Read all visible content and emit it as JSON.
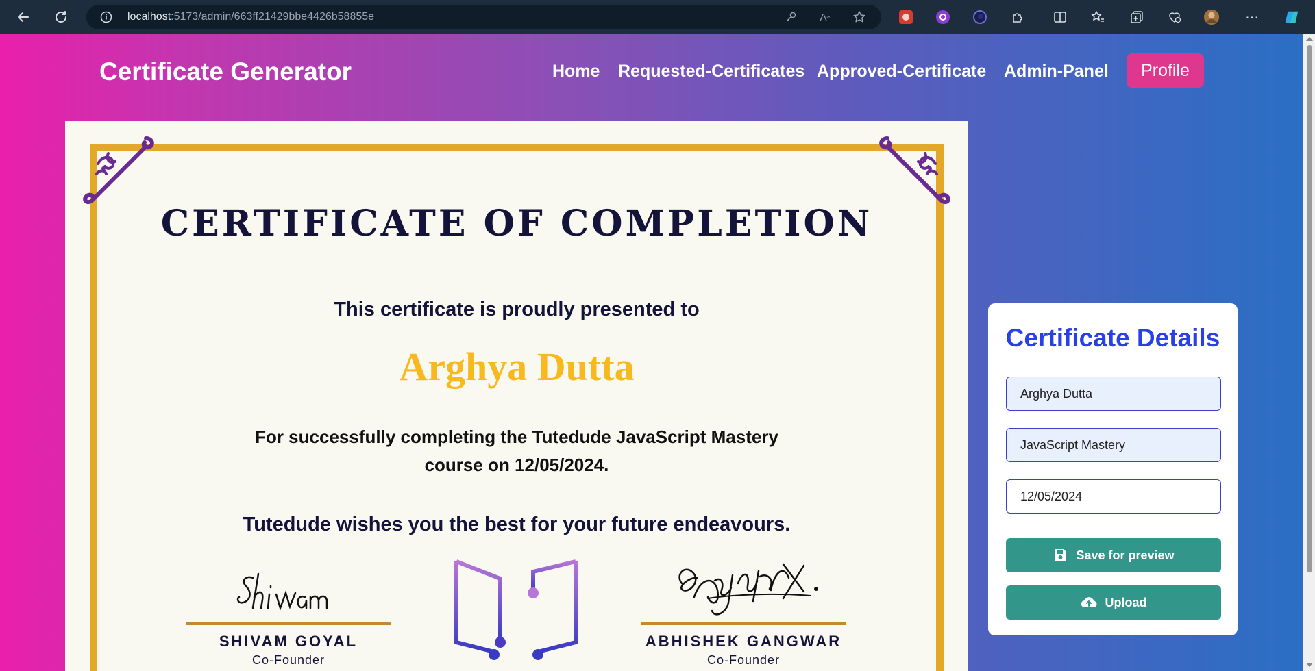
{
  "browser": {
    "url_host": "localhost",
    "url_path": ":5173/admin/663ff21429bbe4426b58855e"
  },
  "navbar": {
    "brand": "Certificate Generator",
    "links": [
      "Home",
      "Requested-Certificates",
      "Approved-Certificate",
      "Admin-Panel"
    ],
    "profile_label": "Profile"
  },
  "certificate": {
    "title": "CERTIFICATE OF COMPLETION",
    "presented": "This certificate is proudly presented to",
    "recipient": "Arghya Dutta",
    "description": "For successfully completing the Tutedude JavaScript Mastery course on 12/05/2024.",
    "wish": "Tutedude wishes you the best for your future endeavours.",
    "signatories": [
      {
        "name": "SHIVAM GOYAL",
        "role": "Co-Founder"
      },
      {
        "name": "ABHISHEK GANGWAR",
        "role": "Co-Founder"
      }
    ],
    "colors": {
      "border": "#e3a828",
      "name": "#f7b91d",
      "ornament": "#6a2a93"
    }
  },
  "details": {
    "title": "Certificate Details",
    "name_value": "Arghya Dutta",
    "course_value": "JavaScript Mastery",
    "date_value": "12/05/2024",
    "save_label": "Save for preview",
    "upload_label": "Upload"
  },
  "colors": {
    "gradient_start": "#ea1fac",
    "gradient_end": "#2a6fc4",
    "profile_button": "#e0378e",
    "action_button": "#33968a",
    "panel_title": "#2840e6"
  }
}
